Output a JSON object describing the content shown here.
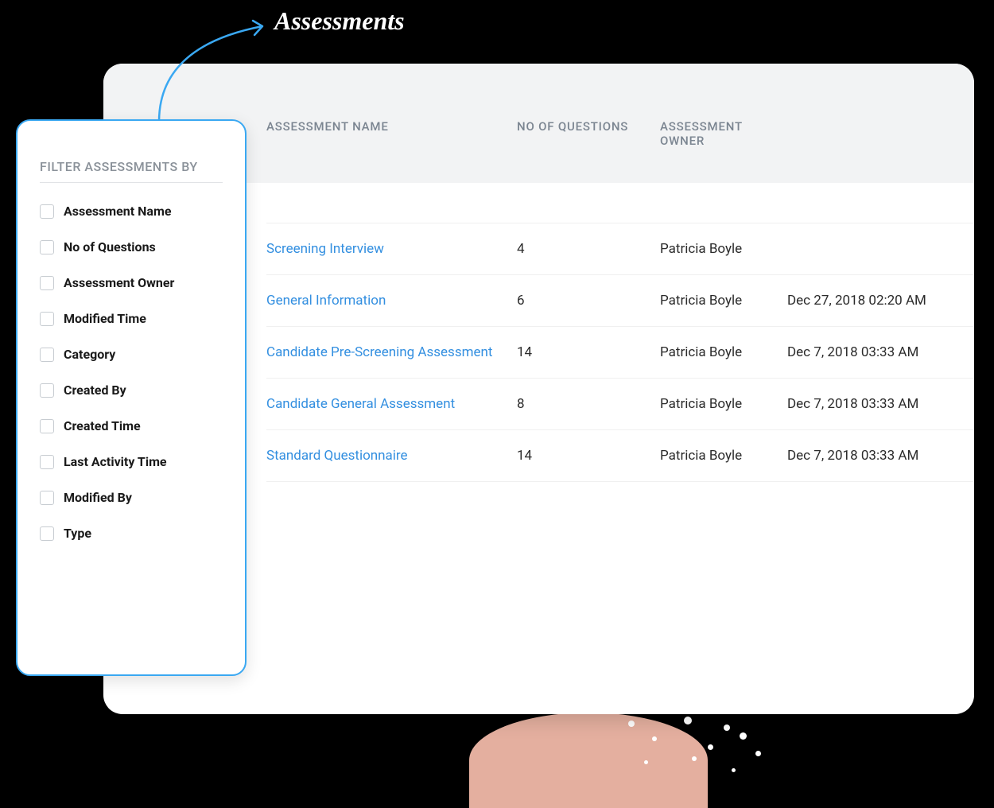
{
  "annotation": {
    "label": "Assessments"
  },
  "filter": {
    "title": "FILTER ASSESSMENTS BY",
    "items": [
      "Assessment Name",
      "No of Questions",
      "Assessment Owner",
      "Modified Time",
      "Category",
      "Created By",
      "Created Time",
      "Last Activity Time",
      "Modified By",
      "Type"
    ]
  },
  "table": {
    "headers": {
      "name": "ASSESSMENT NAME",
      "questions": "NO OF QUESTIONS",
      "owner": "ASSESSMENT OWNER"
    },
    "rows": [
      {
        "name": "Screening Interview",
        "questions": "4",
        "owner": "Patricia Boyle",
        "modified": ""
      },
      {
        "name": "General Information",
        "questions": "6",
        "owner": "Patricia Boyle",
        "modified": "Dec 27, 2018 02:20 AM"
      },
      {
        "name": "Candidate Pre-Screening Assessment",
        "questions": "14",
        "owner": "Patricia Boyle",
        "modified": "Dec 7, 2018 03:33 AM"
      },
      {
        "name": "Candidate General Assessment",
        "questions": "8",
        "owner": "Patricia Boyle",
        "modified": "Dec 7, 2018 03:33 AM"
      },
      {
        "name": "Standard Questionnaire",
        "questions": "14",
        "owner": "Patricia Boyle",
        "modified": "Dec 7, 2018 03:33 AM"
      }
    ]
  }
}
